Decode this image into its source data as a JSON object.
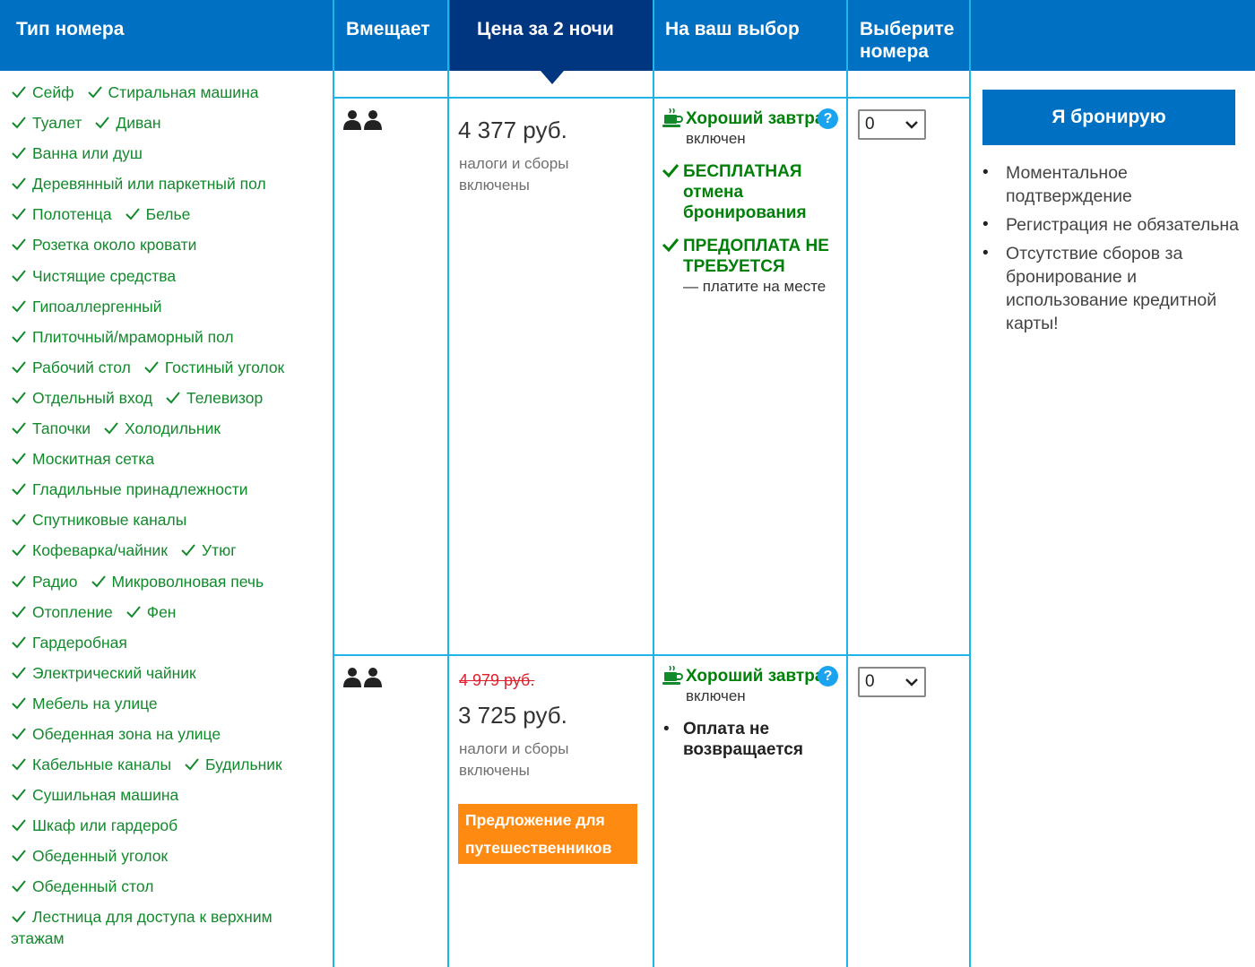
{
  "header": {
    "room_type": "Тип номера",
    "capacity": "Вмещает",
    "price": "Цена за 2 ночи",
    "choice": "На ваш выбор",
    "select": "Выберите номера"
  },
  "facilities": [
    [
      "Сейф",
      "Стиральная машина"
    ],
    [
      "Туалет",
      "Диван"
    ],
    [
      "Ванна или душ"
    ],
    [
      "Деревянный или паркетный пол"
    ],
    [
      "Полотенца",
      "Белье"
    ],
    [
      "Розетка около кровати"
    ],
    [
      "Чистящие средства"
    ],
    [
      "Гипоаллергенный"
    ],
    [
      "Плиточный/мраморный пол"
    ],
    [
      "Рабочий стол",
      "Гостиный уголок"
    ],
    [
      "Отдельный вход",
      "Телевизор"
    ],
    [
      "Тапочки",
      "Холодильник"
    ],
    [
      "Москитная сетка"
    ],
    [
      "Гладильные принадлежности"
    ],
    [
      "Спутниковые каналы"
    ],
    [
      "Кофеварка/чайник",
      "Утюг"
    ],
    [
      "Радио",
      "Микроволновая печь"
    ],
    [
      "Отопление",
      "Фен"
    ],
    [
      "Гардеробная"
    ],
    [
      "Электрический чайник"
    ],
    [
      "Мебель на улице"
    ],
    [
      "Обеденная зона на улице"
    ],
    [
      "Кабельные каналы",
      "Будильник"
    ],
    [
      "Сушильная машина"
    ],
    [
      "Шкаф или гардероб"
    ],
    [
      "Обеденный уголок"
    ],
    [
      "Обеденный стол"
    ]
  ],
  "facility_last": "Лестница для доступа к верхним этажам",
  "offers": [
    {
      "price": "4 377 руб.",
      "tax": "налоги и сборы включены",
      "breakfast_title": "Хороший завтрак",
      "breakfast_sub": "включен",
      "cancel": "БЕСПЛАТНАЯ отмена бронирования",
      "prepay": "ПРЕДОПЛАТА НЕ ТРЕБУЕТСЯ",
      "prepay_sub": "— платите на месте",
      "qty": "0"
    },
    {
      "old_price": "4 979 руб.",
      "price": "3 725 руб.",
      "tax": "налоги и сборы включены",
      "deal": "Предложение для путешественников",
      "breakfast_title": "Хороший завтрак",
      "breakfast_sub": "включен",
      "nonref": "Оплата не возвращается",
      "qty": "0"
    }
  ],
  "book_button": "Я бронирую",
  "benefits": [
    "Моментальное подтверждение",
    "Регистрация не обязательна",
    "Отсутствие сборов за бронирование и использование кредитной карты!"
  ],
  "colors": {
    "header": "#0071c2",
    "selected_header": "#003580",
    "green": "#008009",
    "deal": "#ff8a12",
    "border": "#1fb3e8"
  },
  "icons": {
    "check": "check-icon",
    "people": "two-persons-icon",
    "breakfast": "coffee-cup-icon",
    "help": "question-icon",
    "dropdown": "chevron-down-icon"
  }
}
